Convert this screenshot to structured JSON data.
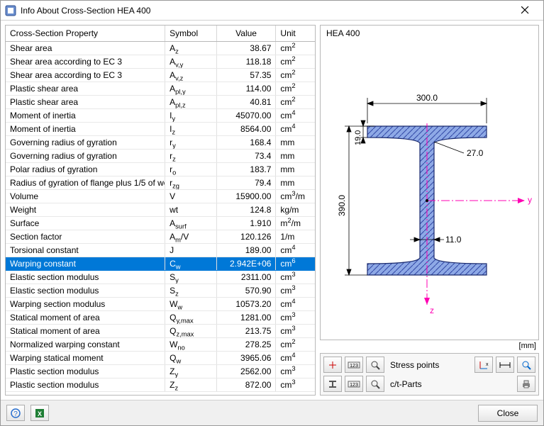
{
  "titlebar": {
    "title": "Info About Cross-Section HEA 400"
  },
  "columns": {
    "prop": "Cross-Section Property",
    "symbol": "Symbol",
    "value": "Value",
    "unit": "Unit"
  },
  "rows": [
    {
      "prop": "Shear area",
      "sym_base": "A",
      "sym_sub": "z",
      "val": "38.67",
      "unit_base": "cm",
      "unit_sup": "2"
    },
    {
      "prop": "Shear area according to EC 3",
      "sym_base": "A",
      "sym_sub": "v,y",
      "val": "118.18",
      "unit_base": "cm",
      "unit_sup": "2"
    },
    {
      "prop": "Shear area according to EC 3",
      "sym_base": "A",
      "sym_sub": "v,z",
      "val": "57.35",
      "unit_base": "cm",
      "unit_sup": "2"
    },
    {
      "prop": "Plastic shear area",
      "sym_base": "A",
      "sym_sub": "pl,y",
      "val": "114.00",
      "unit_base": "cm",
      "unit_sup": "2"
    },
    {
      "prop": "Plastic shear area",
      "sym_base": "A",
      "sym_sub": "pl,z",
      "val": "40.81",
      "unit_base": "cm",
      "unit_sup": "2"
    },
    {
      "prop": "Moment of inertia",
      "sym_base": "I",
      "sym_sub": "y",
      "val": "45070.00",
      "unit_base": "cm",
      "unit_sup": "4"
    },
    {
      "prop": "Moment of inertia",
      "sym_base": "I",
      "sym_sub": "z",
      "val": "8564.00",
      "unit_base": "cm",
      "unit_sup": "4"
    },
    {
      "prop": "Governing radius of gyration",
      "sym_base": "r",
      "sym_sub": "y",
      "val": "168.4",
      "unit_base": "mm",
      "unit_sup": ""
    },
    {
      "prop": "Governing radius of gyration",
      "sym_base": "r",
      "sym_sub": "z",
      "val": "73.4",
      "unit_base": "mm",
      "unit_sup": ""
    },
    {
      "prop": "Polar radius of gyration",
      "sym_base": "r",
      "sym_sub": "o",
      "val": "183.7",
      "unit_base": "mm",
      "unit_sup": ""
    },
    {
      "prop": "Radius of gyration of flange plus 1/5 of we",
      "sym_base": "r",
      "sym_sub": "zg",
      "val": "79.4",
      "unit_base": "mm",
      "unit_sup": ""
    },
    {
      "prop": "Volume",
      "sym_base": "V",
      "sym_sub": "",
      "val": "15900.00",
      "unit_base": "cm",
      "unit_sup": "3",
      "unit_suffix": "/m"
    },
    {
      "prop": "Weight",
      "sym_base": "wt",
      "sym_sub": "",
      "val": "124.8",
      "unit_base": "kg/m",
      "unit_sup": ""
    },
    {
      "prop": "Surface",
      "sym_base": "A",
      "sym_sub": "surf",
      "val": "1.910",
      "unit_base": "m",
      "unit_sup": "2",
      "unit_suffix": "/m"
    },
    {
      "prop": "Section factor",
      "sym_base": "A",
      "sym_sub": "m",
      "sym_suffix": "/V",
      "val": "120.126",
      "unit_base": "1/m",
      "unit_sup": ""
    },
    {
      "prop": "Torsional constant",
      "sym_base": "J",
      "sym_sub": "",
      "val": "189.00",
      "unit_base": "cm",
      "unit_sup": "4"
    },
    {
      "prop": "Warping constant",
      "sym_base": "C",
      "sym_sub": "w",
      "val": "2.942E+06",
      "unit_base": "cm",
      "unit_sup": "6",
      "selected": true
    },
    {
      "prop": "Elastic section modulus",
      "sym_base": "S",
      "sym_sub": "y",
      "val": "2311.00",
      "unit_base": "cm",
      "unit_sup": "3"
    },
    {
      "prop": "Elastic section modulus",
      "sym_base": "S",
      "sym_sub": "z",
      "val": "570.90",
      "unit_base": "cm",
      "unit_sup": "3"
    },
    {
      "prop": "Warping section modulus",
      "sym_base": "W",
      "sym_sub": "w",
      "val": "10573.20",
      "unit_base": "cm",
      "unit_sup": "4"
    },
    {
      "prop": "Statical moment of area",
      "sym_base": "Q",
      "sym_sub": "y,max",
      "val": "1281.00",
      "unit_base": "cm",
      "unit_sup": "3"
    },
    {
      "prop": "Statical moment of area",
      "sym_base": "Q",
      "sym_sub": "z,max",
      "val": "213.75",
      "unit_base": "cm",
      "unit_sup": "3"
    },
    {
      "prop": "Normalized warping constant",
      "sym_base": "W",
      "sym_sub": "no",
      "val": "278.25",
      "unit_base": "cm",
      "unit_sup": "2"
    },
    {
      "prop": "Warping statical moment",
      "sym_base": "Q",
      "sym_sub": "w",
      "val": "3965.06",
      "unit_base": "cm",
      "unit_sup": "4"
    },
    {
      "prop": "Plastic section modulus",
      "sym_base": "Z",
      "sym_sub": "y",
      "val": "2562.00",
      "unit_base": "cm",
      "unit_sup": "3"
    },
    {
      "prop": "Plastic section modulus",
      "sym_base": "Z",
      "sym_sub": "z",
      "val": "872.00",
      "unit_base": "cm",
      "unit_sup": "3"
    }
  ],
  "diagram": {
    "name": "HEA 400",
    "width_label": "300.0",
    "flange_t_label": "19.0",
    "fillet_label": "27.0",
    "height_label": "390.0",
    "web_t_label": "11.0",
    "y_axis": "y",
    "z_axis": "z",
    "unit_legend": "[mm]"
  },
  "tools": {
    "stress_label": "Stress points",
    "ct_label": "c/t-Parts"
  },
  "footer": {
    "close": "Close"
  }
}
